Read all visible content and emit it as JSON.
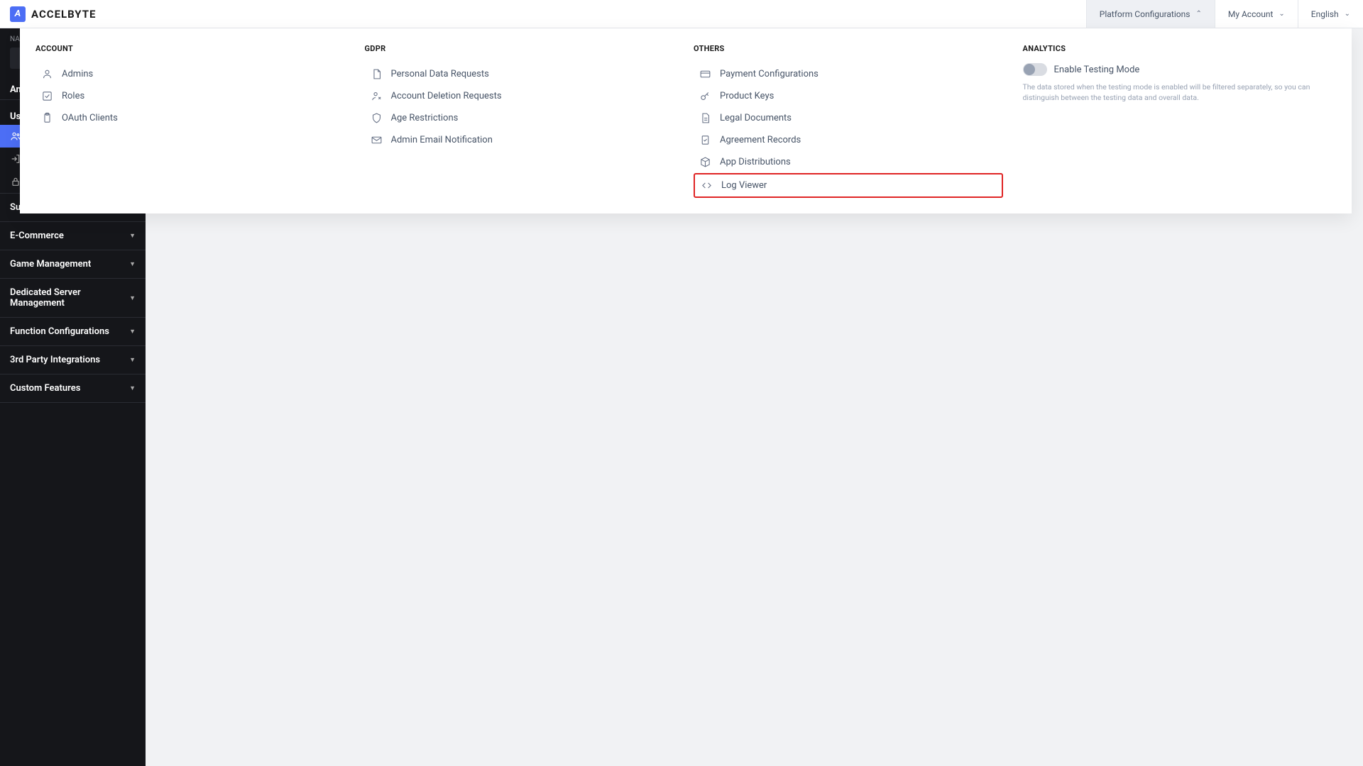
{
  "header": {
    "brand": "ACCELBYTE",
    "logo_letter": "A",
    "nav": {
      "platform": "Platform Configurations",
      "account": "My Account",
      "lang": "English"
    }
  },
  "sidebar": {
    "namespace_label": "NAM",
    "an_label": "An",
    "us_label": "Us",
    "items": [
      "Subscriptions",
      "E-Commerce",
      "Game Management",
      "Dedicated Server Management",
      "Function Configurations",
      "3rd Party Integrations",
      "Custom Features"
    ]
  },
  "mega": {
    "account": {
      "heading": "ACCOUNT",
      "items": [
        "Admins",
        "Roles",
        "OAuth Clients"
      ]
    },
    "gdpr": {
      "heading": "GDPR",
      "items": [
        "Personal Data Requests",
        "Account Deletion Requests",
        "Age Restrictions",
        "Admin Email Notification"
      ]
    },
    "others": {
      "heading": "OTHERS",
      "items": [
        "Payment Configurations",
        "Product Keys",
        "Legal Documents",
        "Agreement Records",
        "App Distributions",
        "Log Viewer"
      ]
    },
    "analytics": {
      "heading": "ANALYTICS",
      "toggle_label": "Enable Testing Mode",
      "desc": "The data stored when the testing mode is enabled will be filtered separately, so you can distinguish between the testing data and overall data."
    }
  }
}
